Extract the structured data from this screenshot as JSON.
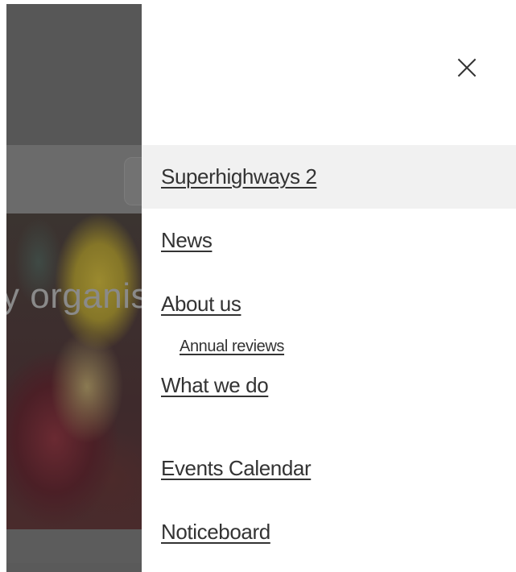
{
  "background": {
    "hero_text": "y organis"
  },
  "drawer": {
    "close_icon": "close-icon",
    "items": [
      {
        "label": "Superhighways 2",
        "active": true,
        "level": 1
      },
      {
        "label": "News",
        "active": false,
        "level": 1
      },
      {
        "label": "About us",
        "active": false,
        "level": 1
      },
      {
        "label": "Annual reviews",
        "active": false,
        "level": 2
      },
      {
        "label": "What we do",
        "active": false,
        "level": 1
      },
      {
        "label": "Events Calendar",
        "active": false,
        "level": 1
      },
      {
        "label": "Noticeboard",
        "active": false,
        "level": 1
      }
    ]
  },
  "colors": {
    "link_text": "#333333",
    "active_row": "#f1f1f1",
    "overlay": "#5a5a5a"
  }
}
